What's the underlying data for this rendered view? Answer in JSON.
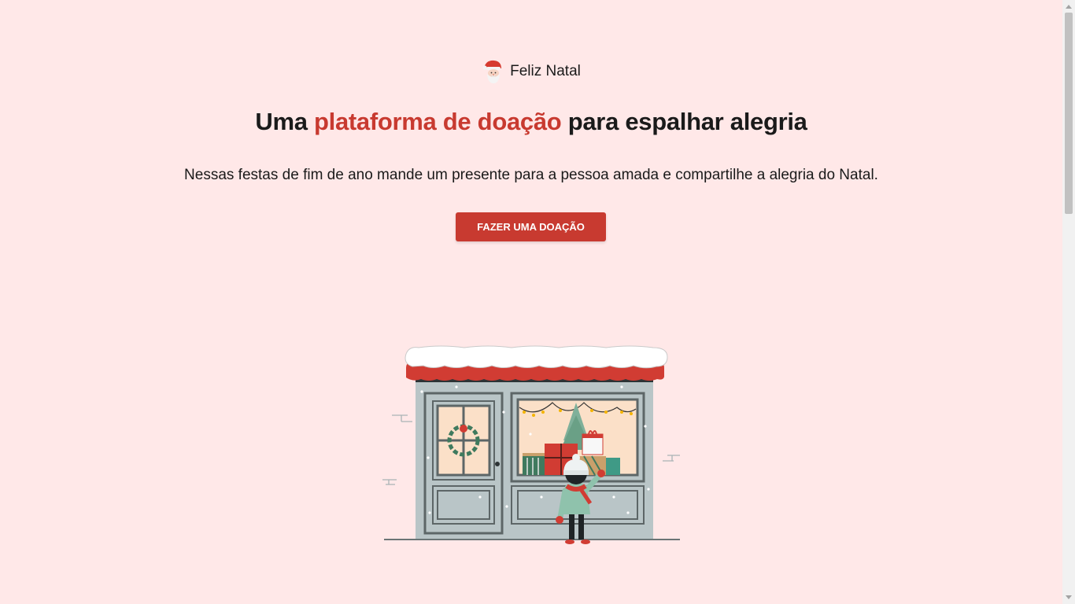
{
  "brand": {
    "name": "Feliz Natal",
    "icon": "santa-claus-icon"
  },
  "hero": {
    "headline_before": "Uma ",
    "headline_accent": "plataforma de doação",
    "headline_after": " para espalhar alegria",
    "lead": "Nessas festas de fim de ano mande um presente para a pessoa amada e compartilhe a alegria do Natal.",
    "cta_label": "FAZER UMA DOAÇÃO"
  },
  "illustration": {
    "icon": "christmas-shop-window-illustration"
  },
  "colors": {
    "background": "#ffe8e8",
    "accent": "#c83a30",
    "text": "#1a1a1a"
  }
}
